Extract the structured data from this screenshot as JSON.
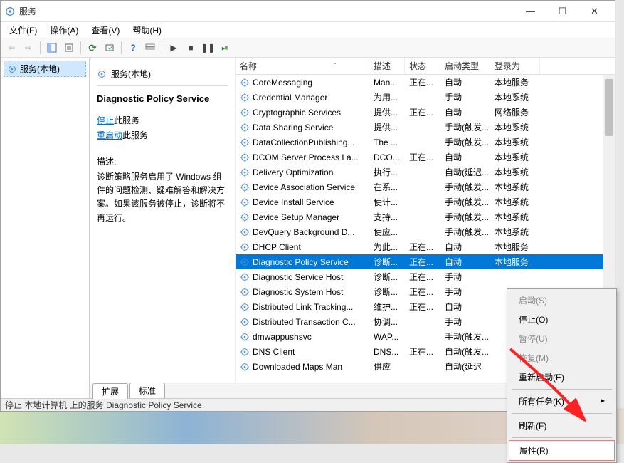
{
  "window": {
    "title": "服务"
  },
  "menu": {
    "file": "文件(F)",
    "action": "操作(A)",
    "view": "查看(V)",
    "help": "帮助(H)"
  },
  "left": {
    "node": "服务(本地)"
  },
  "info": {
    "title_local": "服务(本地)",
    "service_name": "Diagnostic Policy Service",
    "stop_link": "停止",
    "stop_suffix": "此服务",
    "restart_link": "重启动",
    "restart_suffix": "此服务",
    "desc_label": "描述:",
    "desc_text": "诊断策略服务启用了 Windows 组件的问题检测、疑难解答和解决方案。如果该服务被停止，诊断将不再运行。"
  },
  "columns": {
    "name": "名称",
    "desc": "描述",
    "status": "状态",
    "starttype": "启动类型",
    "logon": "登录为"
  },
  "services": [
    {
      "name": "CoreMessaging",
      "desc": "Man...",
      "status": "正在...",
      "starttype": "自动",
      "logon": "本地服务"
    },
    {
      "name": "Credential Manager",
      "desc": "为用...",
      "status": "",
      "starttype": "手动",
      "logon": "本地系统"
    },
    {
      "name": "Cryptographic Services",
      "desc": "提供...",
      "status": "正在...",
      "starttype": "自动",
      "logon": "网络服务"
    },
    {
      "name": "Data Sharing Service",
      "desc": "提供...",
      "status": "",
      "starttype": "手动(触发...",
      "logon": "本地系统"
    },
    {
      "name": "DataCollectionPublishing...",
      "desc": "The ...",
      "status": "",
      "starttype": "手动(触发...",
      "logon": "本地系统"
    },
    {
      "name": "DCOM Server Process La...",
      "desc": "DCO...",
      "status": "正在...",
      "starttype": "自动",
      "logon": "本地系统"
    },
    {
      "name": "Delivery Optimization",
      "desc": "执行...",
      "status": "",
      "starttype": "自动(延迟...",
      "logon": "本地系统"
    },
    {
      "name": "Device Association Service",
      "desc": "在系...",
      "status": "",
      "starttype": "手动(触发...",
      "logon": "本地系统"
    },
    {
      "name": "Device Install Service",
      "desc": "使计...",
      "status": "",
      "starttype": "手动(触发...",
      "logon": "本地系统"
    },
    {
      "name": "Device Setup Manager",
      "desc": "支持...",
      "status": "",
      "starttype": "手动(触发...",
      "logon": "本地系统"
    },
    {
      "name": "DevQuery Background D...",
      "desc": "使应...",
      "status": "",
      "starttype": "手动(触发...",
      "logon": "本地系统"
    },
    {
      "name": "DHCP Client",
      "desc": "为此...",
      "status": "正在...",
      "starttype": "自动",
      "logon": "本地服务"
    },
    {
      "name": "Diagnostic Policy Service",
      "desc": "诊断...",
      "status": "正在...",
      "starttype": "自动",
      "logon": "本地服务",
      "selected": true
    },
    {
      "name": "Diagnostic Service Host",
      "desc": "诊断...",
      "status": "正在...",
      "starttype": "手动",
      "logon": ""
    },
    {
      "name": "Diagnostic System Host",
      "desc": "诊断...",
      "status": "正在...",
      "starttype": "手动",
      "logon": ""
    },
    {
      "name": "Distributed Link Tracking...",
      "desc": "维护...",
      "status": "正在...",
      "starttype": "自动",
      "logon": ""
    },
    {
      "name": "Distributed Transaction C...",
      "desc": "协调...",
      "status": "",
      "starttype": "手动",
      "logon": ""
    },
    {
      "name": "dmwappushsvc",
      "desc": "WAP...",
      "status": "",
      "starttype": "手动(触发...",
      "logon": ""
    },
    {
      "name": "DNS Client",
      "desc": "DNS...",
      "status": "正在...",
      "starttype": "自动(触发...",
      "logon": ""
    },
    {
      "name": "Downloaded Maps Man",
      "desc": "供应",
      "status": "",
      "starttype": "自动(延迟",
      "logon": ""
    }
  ],
  "tabs": {
    "extended": "扩展",
    "standard": "标准"
  },
  "statusbar": "停止 本地计算机 上的服务 Diagnostic Policy Service",
  "context_menu": {
    "start": "启动(S)",
    "stop": "停止(O)",
    "pause": "暂停(U)",
    "resume": "恢复(M)",
    "restart": "重新启动(E)",
    "all_tasks": "所有任务(K)",
    "refresh": "刷新(F)",
    "properties": "属性(R)"
  }
}
